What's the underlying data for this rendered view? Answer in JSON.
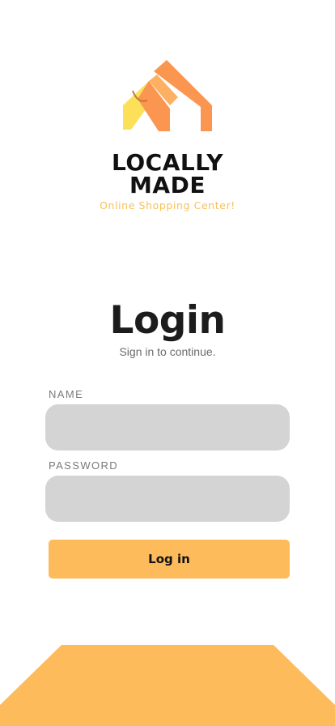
{
  "brand": {
    "name_line1": "LOCALLY",
    "name_line2": "MADE",
    "tagline": "Online Shopping Center!",
    "logo_icon": "house-roof-logo-icon"
  },
  "login": {
    "title": "Login",
    "subtitle": "Sign in to continue.",
    "name_label": "NAME",
    "name_value": "",
    "password_label": "PASSWORD",
    "password_value": "",
    "button_label": "Log in"
  },
  "colors": {
    "accent": "#fdbb5c",
    "logo_orange": "#fb9651",
    "logo_yellow": "#fde05a",
    "tagline": "#f6c15b",
    "field_bg": "#d4d4d4"
  }
}
